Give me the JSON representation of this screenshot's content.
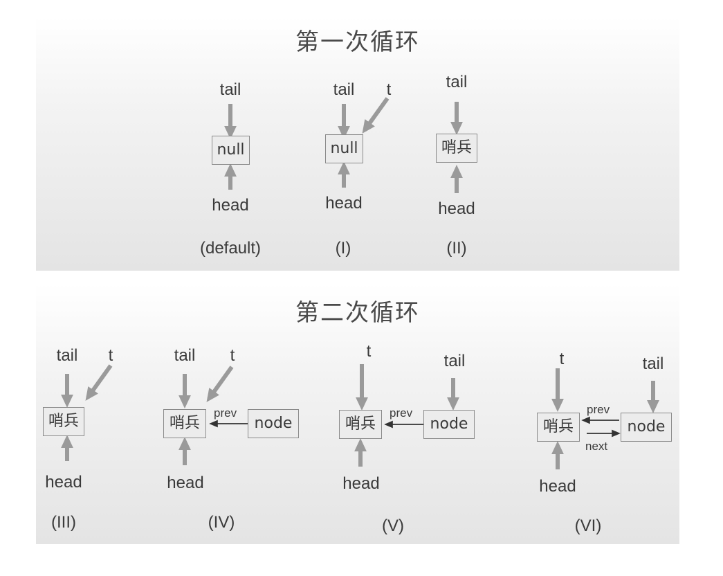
{
  "loop1": {
    "title": "第一次循环",
    "stages": [
      {
        "tail": "tail",
        "box": "null",
        "head": "head",
        "caption": "(default)"
      },
      {
        "tail": "tail",
        "t": "t",
        "box": "null",
        "head": "head",
        "caption": "(I)"
      },
      {
        "tail": "tail",
        "box": "哨兵",
        "head": "head",
        "caption": "(II)"
      }
    ]
  },
  "loop2": {
    "title": "第二次循环",
    "stages": [
      {
        "tail": "tail",
        "t": "t",
        "box": "哨兵",
        "head": "head",
        "caption": "(III)"
      },
      {
        "tail": "tail",
        "t": "t",
        "box": "哨兵",
        "node": "node",
        "prev": "prev",
        "head": "head",
        "caption": "(IV)"
      },
      {
        "t": "t",
        "tail": "tail",
        "box": "哨兵",
        "node": "node",
        "prev": "prev",
        "head": "head",
        "caption": "(V)"
      },
      {
        "t": "t",
        "tail": "tail",
        "box": "哨兵",
        "node": "node",
        "prev": "prev",
        "next": "next",
        "head": "head",
        "caption": "(VI)"
      }
    ]
  },
  "colors": {
    "arrow_gray": "#9a9a9a",
    "arrow_dark": "#333333",
    "text": "#3a3a3a"
  }
}
